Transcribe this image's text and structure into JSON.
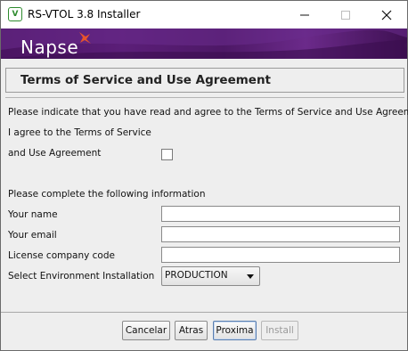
{
  "window": {
    "title": "RS-VTOL 3.8 Installer",
    "icon_letter": "V"
  },
  "banner": {
    "brand": "Napse",
    "colors": {
      "purple": "#4a1461",
      "accent": "#e8542a"
    }
  },
  "section": {
    "heading": "Terms of Service and Use Agreement"
  },
  "agreement": {
    "intro": "Please indicate that you have read and agree to the Terms of Service and Use Agreement",
    "line1": "I agree to the Terms of Service",
    "line2": "and Use Agreement",
    "checked": false
  },
  "form": {
    "intro": "Please complete the following information",
    "name_label": "Your name",
    "name_value": "",
    "email_label": "Your email",
    "email_value": "",
    "license_label": "License company code",
    "license_value": "",
    "env_label": "Select Environment Installation",
    "env_value": "PRODUCTION"
  },
  "footer": {
    "cancel": "Cancelar",
    "back": "Atras",
    "next": "Proxima",
    "install": "Install"
  }
}
